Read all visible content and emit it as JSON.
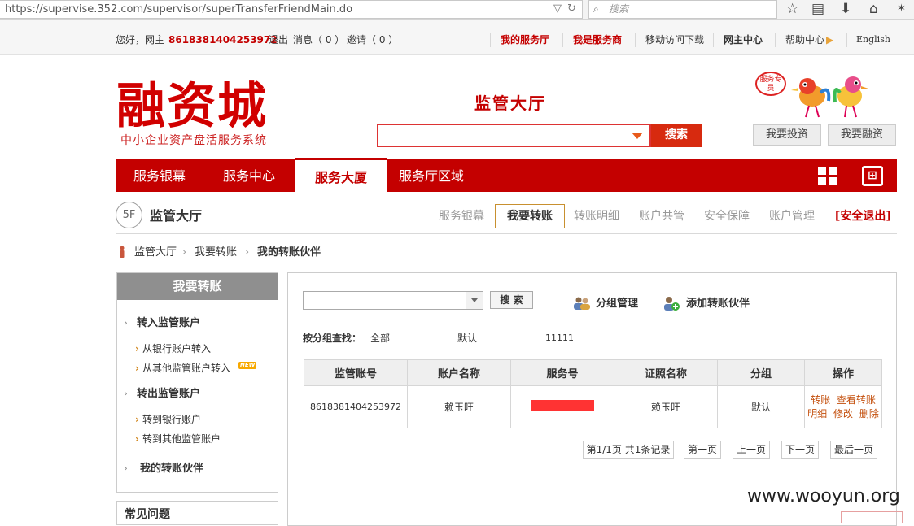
{
  "browser": {
    "url": "https://supervise.352.com/supervisor/superTransferFriendMain.do",
    "search_placeholder": "搜索"
  },
  "topbar": {
    "greeting": "您好，网主",
    "account": "8618381404253972",
    "logout": "退出",
    "messages": "消息（ 0 ）",
    "invites": "邀请（ 0 ）",
    "links": [
      "我的服务厅",
      "我是服务商",
      "移动访问下载",
      "网主中心",
      "帮助中心",
      "English"
    ]
  },
  "header": {
    "logo": "融资城",
    "logo_sub": "中小企业资产盘活服务系统",
    "hall_title": "监管大厅",
    "search_button": "搜索",
    "invest_button": "我要投资",
    "finance_button": "我要融资",
    "service_badge": "服务专员"
  },
  "main_nav": {
    "items": [
      "服务银幕",
      "服务中心",
      "服务大厦",
      "服务厅区域"
    ],
    "active": "服务大厦"
  },
  "sub_nav": {
    "floor": "5F",
    "title": "监管大厅",
    "items": [
      "服务银幕",
      "我要转账",
      "转账明细",
      "账户共管",
      "安全保障",
      "账户管理"
    ],
    "active": "我要转账",
    "logout": "[安全退出]"
  },
  "breadcrumb": {
    "items": [
      "监管大厅",
      "我要转账",
      "我的转账伙伴"
    ]
  },
  "sidebar": {
    "title": "我要转账",
    "sections": [
      {
        "title": "转入监管账户",
        "links": [
          "从银行账户转入",
          "从其他监管账户转入"
        ]
      },
      {
        "title": "转出监管账户",
        "links": [
          "转到银行账户",
          "转到其他监管账户"
        ]
      },
      {
        "title": "我的转账伙伴",
        "links": []
      }
    ],
    "new_badge": "NEW",
    "faq_title": "常见问题"
  },
  "panel": {
    "search_button": "搜 索",
    "group_manage": "分组管理",
    "add_partner": "添加转账伙伴",
    "filter_label": "按分组查找：",
    "filter_options": [
      "全部",
      "默认",
      "11111"
    ],
    "table": {
      "headers": [
        "监管账号",
        "账户名称",
        "服务号",
        "证照名称",
        "分组",
        "操作"
      ],
      "rows": [
        {
          "account": "8618381404253972",
          "name": "赖玉旺",
          "service_no": "",
          "license_name": "赖玉旺",
          "group": "默认",
          "ops": [
            "转账",
            "查看转账",
            "明细",
            "修改",
            "删除"
          ]
        }
      ]
    },
    "pagination": {
      "info": "第1/1页 共1条记录",
      "first": "第一页",
      "prev": "上一页",
      "next": "下一页",
      "last": "最后一页"
    }
  },
  "watermark": "www.wooyun.org",
  "colors": {
    "brand_red": "#c40000",
    "accent_orange": "#e85a1b",
    "link_orange": "#c4500e"
  }
}
